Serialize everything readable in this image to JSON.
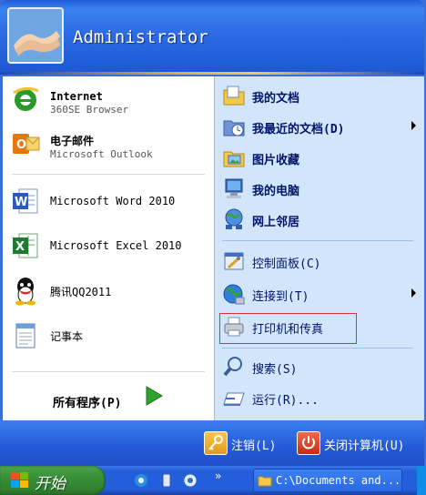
{
  "user": {
    "name": "Administrator"
  },
  "pinned": [
    {
      "title": "Internet",
      "subtitle": "360SE Browser",
      "icon": "ie-icon"
    },
    {
      "title": "电子邮件",
      "subtitle": "Microsoft Outlook",
      "icon": "outlook-icon"
    }
  ],
  "recent": [
    {
      "title": "Microsoft Word 2010",
      "icon": "word-icon"
    },
    {
      "title": "Microsoft Excel 2010",
      "icon": "excel-icon"
    },
    {
      "title": "腾讯QQ2011",
      "icon": "qq-icon"
    },
    {
      "title": "记事本",
      "icon": "notepad-icon"
    }
  ],
  "all_programs": "所有程序(P)",
  "places": [
    {
      "label": "我的文档",
      "icon": "my-documents-icon",
      "bold": true
    },
    {
      "label": "我最近的文档(D)",
      "icon": "recent-documents-icon",
      "bold": true,
      "submenu": true
    },
    {
      "label": "图片收藏",
      "icon": "my-pictures-icon",
      "bold": true
    },
    {
      "label": "我的电脑",
      "icon": "my-computer-icon",
      "bold": true
    },
    {
      "label": "网上邻居",
      "icon": "network-places-icon",
      "bold": true
    },
    {
      "label": "控制面板(C)",
      "icon": "control-panel-icon",
      "bold": false
    },
    {
      "label": "连接到(T)",
      "icon": "connect-to-icon",
      "bold": false,
      "submenu": true
    },
    {
      "label": "打印机和传真",
      "icon": "printers-faxes-icon",
      "bold": false
    },
    {
      "label": "搜索(S)",
      "icon": "search-icon",
      "bold": false
    },
    {
      "label": "运行(R)...",
      "icon": "run-icon",
      "bold": false
    }
  ],
  "footer": {
    "logoff": "注销(L)",
    "shutdown": "关闭计算机(U)"
  },
  "taskbar": {
    "start": "开始",
    "task": "C:\\Documents and..."
  },
  "colors": {
    "highlight": "#e03030",
    "right_pane": "#d3e5fa",
    "start_green": "#3c943c",
    "header_blue": "#2c6be4"
  }
}
